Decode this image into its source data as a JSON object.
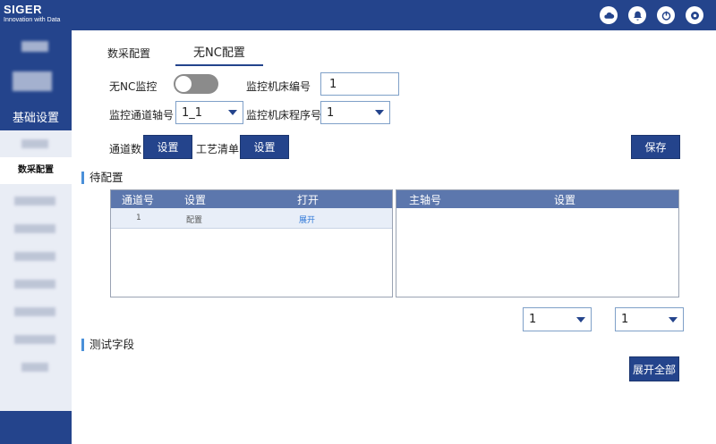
{
  "brand": {
    "name": "SIGER",
    "tagline": "Innovation with Data"
  },
  "sidebar": {
    "section_label": "基础设置",
    "active_item_label": "数采配置"
  },
  "tabs": [
    {
      "label": "数采配置",
      "active": false
    },
    {
      "label": "无NC配置",
      "active": true
    }
  ],
  "form": {
    "no_nc_monitor_label": "无NC监控",
    "no_nc_monitor_on": false,
    "machine_number_label": "监控机床编号",
    "machine_number_value": "1",
    "channel_axis_label": "监控通道轴号",
    "channel_axis_value": "1_1",
    "machine_program_label": "监控机床程序号",
    "machine_program_value": "1",
    "channel_count_label": "通道数",
    "channel_set_button": "设置",
    "process_list_label": "工艺清单",
    "process_set_button": "设置",
    "save_button": "保存"
  },
  "pending": {
    "title": "待配置",
    "left_table": {
      "columns": [
        "通道号",
        "设置",
        "打开"
      ],
      "rows": [
        {
          "channel": "1",
          "setting": "配置",
          "open": "展开"
        }
      ]
    },
    "right_table": {
      "columns": [
        "主轴号",
        "设置"
      ]
    },
    "left_select_value": "1",
    "right_select_value": "1"
  },
  "test": {
    "title": "测试字段",
    "expand_all_button": "展开全部"
  },
  "colors": {
    "primary": "#24448c",
    "table_header": "#5c77ad",
    "accent": "#4a90d9"
  }
}
